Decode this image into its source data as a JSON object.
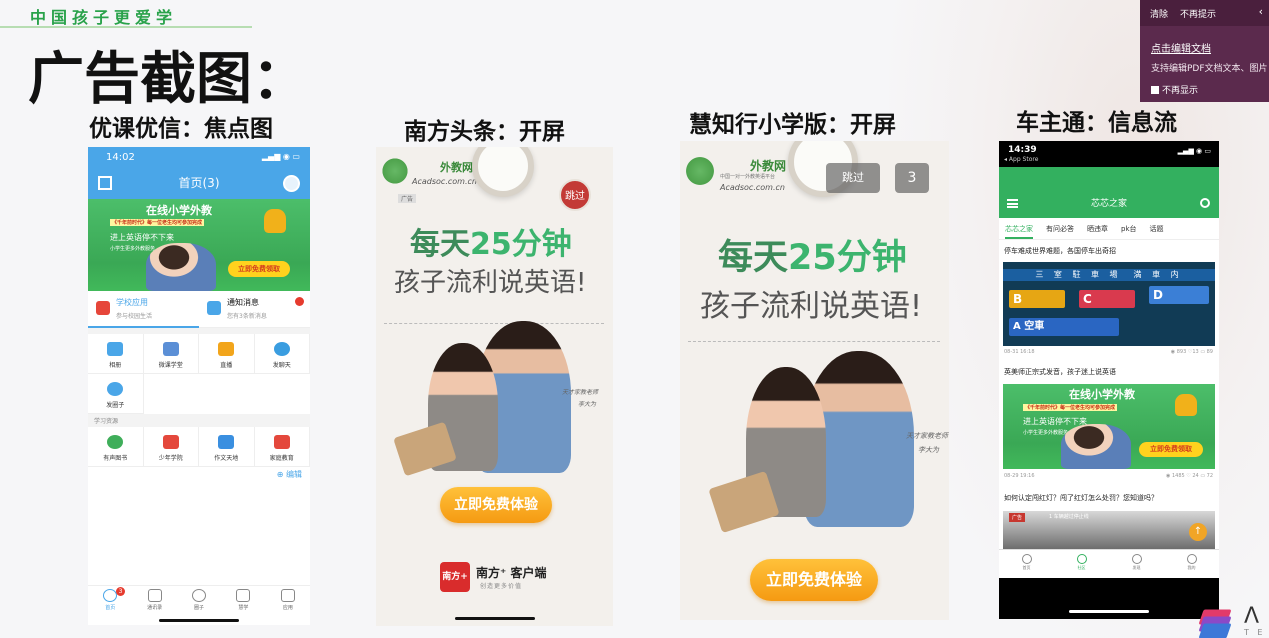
{
  "brand_slogan": "中国孩子更爱学",
  "page_title": "广告截图：",
  "sections": {
    "youke": "优课优信：焦点图",
    "nanfang": "南方头条：开屏",
    "huizhi": "慧知行小学版：开屏",
    "chezhu": "车主通：信息流"
  },
  "phone1": {
    "time": "14:02",
    "signal": "▂▄▆ ◉ ▭",
    "nav_title": "首页(3)",
    "banner": {
      "title": "在线小学外教",
      "tagline": "《千年前时代》每一位老生均可参加完成",
      "line1": "进上英语停不下来",
      "line2": "小学生更多外教服务",
      "button": "立即免费领取"
    },
    "notify": {
      "school_title": "学校应用",
      "school_sub": "参与校园生活",
      "notice_title": "通知消息",
      "notice_sub": "您有3条新消息",
      "badge": "1"
    },
    "grid1": [
      "相册",
      "微课学堂",
      "直播",
      "发聊天"
    ],
    "grid1_extra": "发圈子",
    "section_label": "学习资源",
    "grid2": [
      "有声图书",
      "少年学院",
      "作文天地",
      "家庭教育"
    ],
    "edit": "⊕ 编辑",
    "tabs": [
      "首页",
      "通讯录",
      "圈子",
      "慧学",
      "应用"
    ],
    "tab_badge": "3"
  },
  "splash": {
    "logo_name": "外教网",
    "logo_sub": "中国一对一外教英语平台",
    "logo_url": "Acadsoc.com.cn",
    "headline_a": "每天",
    "headline_b": "25分钟",
    "headline2": "孩子流利说英语!",
    "signature": "天才家教老师",
    "signature_name": "李大为",
    "cta": "立即免费体验"
  },
  "phone2": {
    "skip": "跳过",
    "ad_tag": "广告",
    "brand_icon": "南方+",
    "brand_name": "南方⁺ 客户端",
    "brand_sub": "创造更多价值"
  },
  "phone3": {
    "skip": "跳过",
    "countdown": "3"
  },
  "phone4": {
    "time": "14:39",
    "store": "◂ App Store",
    "signal": "▂▄▆ ◉ ▭",
    "nav_title": "芯芯之家",
    "tabs": [
      "芯芯之家",
      "有问必答",
      "晒违章",
      "pk台",
      "话题"
    ],
    "item1_title": "停车难成世界难题，各国停车出奇招",
    "item1_sign": "三 室 駐 車 場　満 車 内",
    "item1_slots": [
      "B",
      "C",
      "D",
      "A 空車"
    ],
    "item1_date": "08-31 16:18",
    "item1_stats": "◉ 893  ♡13  ▭ 89",
    "item2_title": "英美师正宗式发音，孩子迷上说英语",
    "item2_date": "08-29 19:16",
    "item2_stats": "◉ 1485  ♡ 24  ▭ 72",
    "item3_title": "如何认定闯红灯？闯了红灯怎么处罚？您知道吗？",
    "item3_tag": "广告",
    "item3_label": "1 车辆越过停止线",
    "item3_icon": "↑",
    "tabbar": [
      "首页",
      "社区",
      "发现",
      "我的"
    ]
  },
  "popup": {
    "clear": "清除",
    "never": "不再提示",
    "back": "‹",
    "link": "点击编辑文档",
    "desc": "支持编辑PDF文档文本、图片",
    "checkbox": "不再显示"
  },
  "footer": {
    "caret": "Λ",
    "te": "T E"
  },
  "colors": {
    "brand_green": "#29a24a",
    "youke_blue": "#4aa6e8",
    "chezhu_green": "#33b05f",
    "cta_orange": "#f59a12",
    "popup_purple": "#5b2a4d"
  }
}
